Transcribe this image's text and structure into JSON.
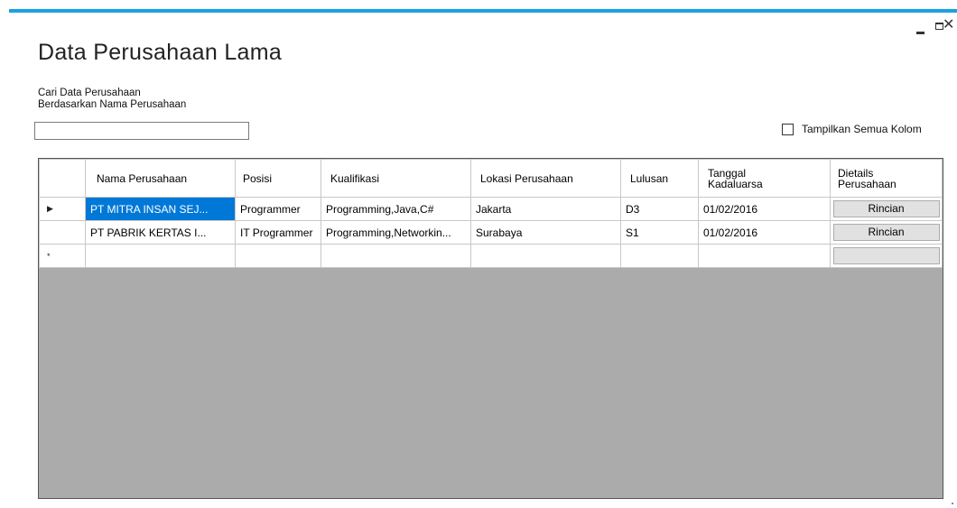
{
  "window": {
    "title": "Data Perusahaan Lama",
    "minimize_icon": "minimize-icon",
    "maximize_icon": "maximize-icon",
    "close_glyph": "✕",
    "accent_color": "#1ba1e2"
  },
  "search": {
    "label_line1": "Cari Data Perusahaan",
    "label_line2": "Berdasarkan Nama Perusahaan",
    "value": ""
  },
  "show_all_columns": {
    "label": "Tampilkan Semua Kolom",
    "checked": false
  },
  "grid": {
    "columns": [
      {
        "line1": "Nama Perusahaan",
        "line2": ""
      },
      {
        "line1": "Posisi",
        "line2": ""
      },
      {
        "line1": "Kualifikasi",
        "line2": ""
      },
      {
        "line1": "Lokasi Perusahaan",
        "line2": ""
      },
      {
        "line1": "Lulusan",
        "line2": ""
      },
      {
        "line1": "Tanggal",
        "line2": "Kadaluarsa"
      },
      {
        "line1": "Dietails",
        "line2": "Perusahaan"
      }
    ],
    "current_row_glyph": "▶",
    "new_row_glyph": "*",
    "rows": [
      {
        "nama": "PT MITRA INSAN SEJ...",
        "posisi": "Programmer",
        "kualifikasi": "Programming,Java,C#",
        "lokasi": "Jakarta",
        "lulusan": "D3",
        "tanggal": "01/02/2016",
        "button": "Rincian"
      },
      {
        "nama": "PT PABRIK KERTAS I...",
        "posisi": "IT Programmer",
        "kualifikasi": "Programming,Networkin...",
        "lokasi": "Surabaya",
        "lulusan": "S1",
        "tanggal": "01/02/2016",
        "button": "Rincian"
      }
    ]
  }
}
